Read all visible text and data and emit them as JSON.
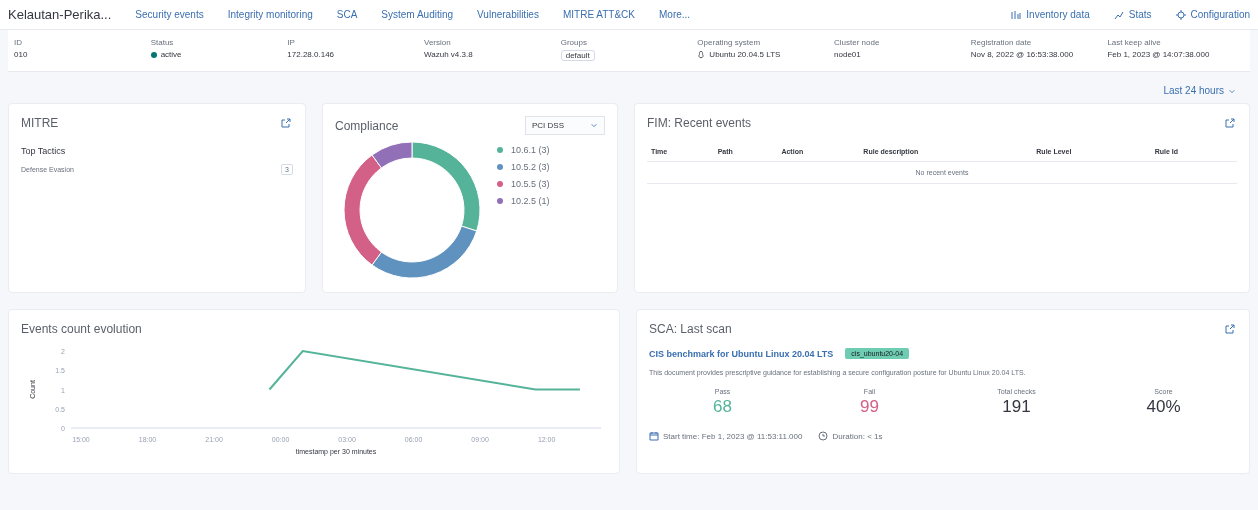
{
  "agent_name": "Kelautan-Perika...",
  "nav": [
    {
      "label": "Security events",
      "selected": false
    },
    {
      "label": "Integrity monitoring",
      "selected": false
    },
    {
      "label": "SCA",
      "selected": false
    },
    {
      "label": "System Auditing",
      "selected": false
    },
    {
      "label": "Vulnerabilities",
      "selected": false
    },
    {
      "label": "MITRE ATT&CK",
      "selected": false
    },
    {
      "label": "More...",
      "selected": false
    }
  ],
  "actions": [
    {
      "kind": "inventory",
      "label": "Inventory data"
    },
    {
      "kind": "stats",
      "label": "Stats"
    },
    {
      "kind": "config",
      "label": "Configuration"
    }
  ],
  "info": [
    {
      "label": "ID",
      "value": "010"
    },
    {
      "label": "Status",
      "value": "active",
      "kind": "status",
      "color": "#007871"
    },
    {
      "label": "IP",
      "value": "172.28.0.146"
    },
    {
      "label": "Version",
      "value": "Wazuh v4.3.8"
    },
    {
      "label": "Groups",
      "value": "default",
      "kind": "badge"
    },
    {
      "label": "Operating system",
      "value": "Ubuntu 20.04.5 LTS",
      "kind": "os"
    },
    {
      "label": "Cluster node",
      "value": "node01"
    },
    {
      "label": "Registration date",
      "value": "Nov 8, 2022 @ 16:53:38.000"
    },
    {
      "label": "Last keep alive",
      "value": "Feb 1, 2023 @ 14:07:38.000"
    }
  ],
  "time_range": "Last 24 hours",
  "mitre": {
    "title": "MITRE",
    "subtitle": "Top Tactics",
    "tactics": [
      {
        "name": "Defense Evasion",
        "count": "3"
      }
    ]
  },
  "compliance": {
    "title": "Compliance",
    "selector": "PCI DSS",
    "chart_data": {
      "type": "donut",
      "categories": [
        "10.6.1 (3)",
        "10.5.2 (3)",
        "10.5.5 (3)",
        "10.2.5 (1)"
      ],
      "values": [
        3,
        3,
        3,
        1
      ]
    }
  },
  "fim": {
    "title": "FIM: Recent events",
    "columns": [
      "Time",
      "Path",
      "Action",
      "Rule description",
      "Rule Level",
      "Rule Id"
    ],
    "empty": "No recent events"
  },
  "events": {
    "title": "Events count evolution",
    "chart_data": {
      "type": "line",
      "xlabel": "timestamp per 30 minutes",
      "ylabel": "Count",
      "categories": [
        "15:00",
        null,
        null,
        null,
        null,
        null,
        "18:00",
        null,
        null,
        null,
        null,
        null,
        "21:00",
        null,
        null,
        null,
        null,
        null,
        "00:00",
        null,
        null,
        null,
        null,
        null,
        "03:00",
        null,
        null,
        null,
        null,
        null,
        "06:00",
        null,
        null,
        null,
        null,
        null,
        "09:00",
        null,
        null,
        null,
        null,
        null,
        "12:00",
        null,
        null,
        null,
        null
      ],
      "series": [
        {
          "color": "#54b399",
          "values": [
            null,
            null,
            null,
            null,
            null,
            null,
            null,
            null,
            null,
            null,
            null,
            null,
            null,
            null,
            null,
            null,
            null,
            1,
            null,
            null,
            2,
            null,
            null,
            null,
            null,
            null,
            null,
            null,
            null,
            null,
            null,
            null,
            null,
            null,
            null,
            null,
            null,
            null,
            null,
            null,
            null,
            1,
            null,
            null,
            null,
            1,
            null
          ]
        }
      ],
      "ylim": [
        0,
        2
      ],
      "yticks": [
        0,
        0.5,
        1,
        1.5,
        2
      ]
    }
  },
  "sca": {
    "title": "SCA: Last scan",
    "policy": "CIS benchmark for Ubuntu Linux 20.04 LTS",
    "policy_id": "cis_ubuntu20-04",
    "description": "This document provides prescriptive guidance for establishing a secure configuration posture for Ubuntu Linux 20.04 LTS.",
    "stats": [
      {
        "label": "Pass",
        "value": "68",
        "kind": "pass"
      },
      {
        "label": "Fail",
        "value": "99",
        "kind": "fail"
      },
      {
        "label": "Total checks",
        "value": "191",
        "kind": "plain"
      },
      {
        "label": "Score",
        "value": "40%",
        "kind": "plain"
      }
    ],
    "start_time": "Start time: Feb 1, 2023 @ 11:53:11.000",
    "duration": "Duration: < 1s"
  }
}
